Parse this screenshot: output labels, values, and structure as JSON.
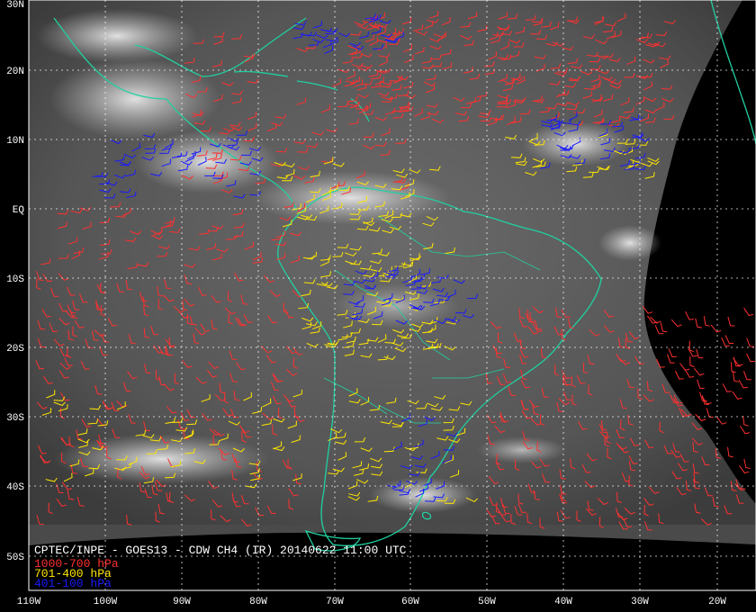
{
  "title": "CPTEC/INPE - GOES13 - CDW CH4 (IR) 20140622 11:00 UTC",
  "legend": [
    {
      "label": "1000-700 hPa",
      "color": "#ff3030"
    },
    {
      "label": "701-400 hPa",
      "color": "#ffe600"
    },
    {
      "label": "401-100 hPa",
      "color": "#1a1aff"
    }
  ],
  "lat_labels": [
    "30N",
    "20N",
    "10N",
    "EQ",
    "10S",
    "20S",
    "30S",
    "40S",
    "50S"
  ],
  "lon_labels": [
    "110W",
    "100W",
    "90W",
    "80W",
    "70W",
    "60W",
    "50W",
    "40W",
    "30W",
    "20W"
  ],
  "colors": {
    "coastline": "#20d0a0",
    "grid": "#ffffff",
    "space": "#000000",
    "frame": "#ffffff"
  }
}
